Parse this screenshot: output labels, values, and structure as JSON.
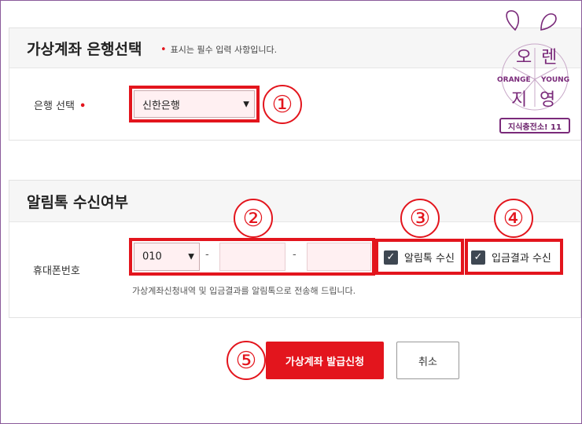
{
  "colors": {
    "accent": "#e3151d",
    "checkbox": "#3e4752",
    "input_bg": "#fff0f2",
    "logo_purple": "#7a2a7a"
  },
  "bank_section": {
    "title": "가상계좌 은행선택",
    "required_note": "표시는 필수 입력 사항입니다.",
    "bank_label": "은행 선택",
    "bank_value": "신한은행"
  },
  "alert_section": {
    "title": "알림톡 수신여부",
    "phone_label": "휴대폰번호",
    "phone_prefix": "010",
    "phone_separator_1": "-",
    "phone_separator_2": "-",
    "phone_middle": "",
    "phone_last": "",
    "alimtalk_label": "알림톡 수신",
    "deposit_result_label": "입금결과 수신",
    "help_text": "가상계좌신청내역 및 입금결과를 알림톡으로 전송해 드립니다."
  },
  "buttons": {
    "submit": "가상계좌 발급신청",
    "cancel": "취소"
  },
  "annotations": [
    "①",
    "②",
    "③",
    "④",
    "⑤"
  ],
  "logo": {
    "line1_a": "오",
    "line1_b": "렌",
    "line2_a": "지",
    "line2_b": "영",
    "en_1": "ORANGE",
    "en_2": "YOUNG",
    "subtitle": "지식충전소! 11"
  }
}
